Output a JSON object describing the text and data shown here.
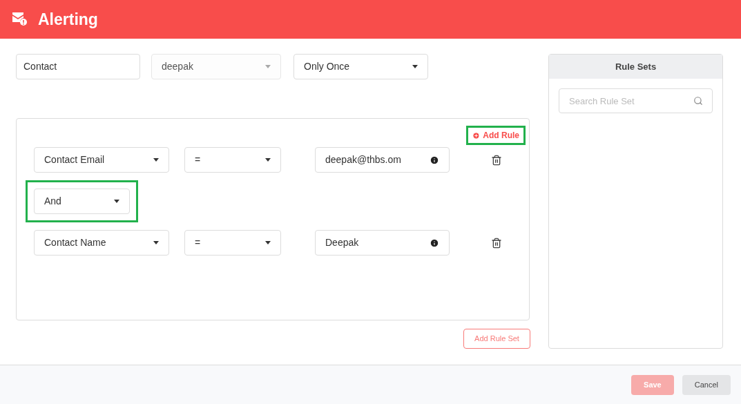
{
  "header": {
    "title": "Alerting"
  },
  "filters": [
    {
      "kind": "input",
      "value": "Contact"
    },
    {
      "kind": "select",
      "value": "deepak",
      "disabled": true
    },
    {
      "kind": "select",
      "value": "Only Once",
      "disabled": false
    }
  ],
  "rule_set": {
    "add_rule": {
      "label": "Add Rule",
      "highlighted": true
    },
    "rules": [
      {
        "field": "Contact Email",
        "operator": "=",
        "value": "deepak@thbs.om"
      },
      {
        "kind": "joiner",
        "value": "And",
        "highlighted": true
      },
      {
        "field": "Contact Name",
        "operator": "=",
        "value": "Deepak"
      }
    ]
  },
  "add_rule_set": "Add Rule Set",
  "rule_sets": {
    "title": "Rule Sets",
    "search": {
      "placeholder": "Search Rule Set"
    }
  },
  "footer": {
    "buttons": [
      {
        "label": "Save",
        "kind": "primary",
        "disabled": true
      },
      {
        "label": "Cancel",
        "kind": "secondary",
        "disabled": false
      }
    ]
  }
}
